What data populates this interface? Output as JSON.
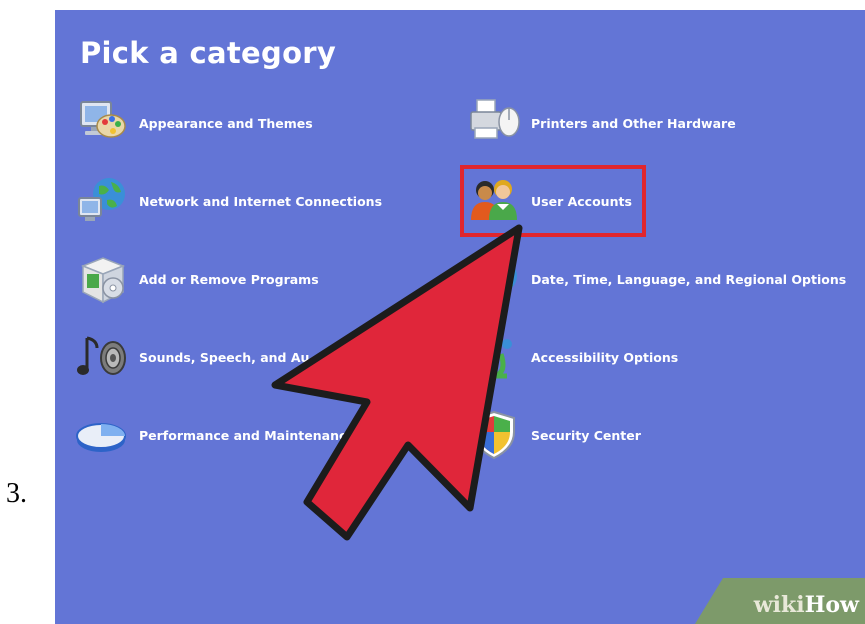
{
  "step_number": "3.",
  "panel": {
    "title": "Pick a category",
    "background_color": "#6375d6"
  },
  "categories": [
    {
      "label": "Appearance and Themes",
      "icon": "appearance-themes-icon"
    },
    {
      "label": "Network and Internet Connections",
      "icon": "network-globe-icon"
    },
    {
      "label": "Add or Remove Programs",
      "icon": "add-remove-programs-icon"
    },
    {
      "label": "Sounds, Speech, and Au",
      "icon": "sounds-speaker-icon"
    },
    {
      "label": "Performance and Maintenanc",
      "icon": "performance-pie-icon"
    },
    {
      "label": "Printers and Other Hardware",
      "icon": "printer-mouse-icon"
    },
    {
      "label": "User Accounts",
      "icon": "user-accounts-icon"
    },
    {
      "label": "Date, Time, Language, and Regional Options",
      "icon": "date-time-globe-icon"
    },
    {
      "label": "Accessibility Options",
      "icon": "accessibility-icon"
    },
    {
      "label": "Security Center",
      "icon": "security-shield-icon"
    }
  ],
  "annotation": {
    "highlight_target": "User Accounts",
    "highlight_color": "#e0262e",
    "arrow_color": "#e0263a"
  },
  "watermark": {
    "part1": "wiki",
    "part2": "How"
  }
}
